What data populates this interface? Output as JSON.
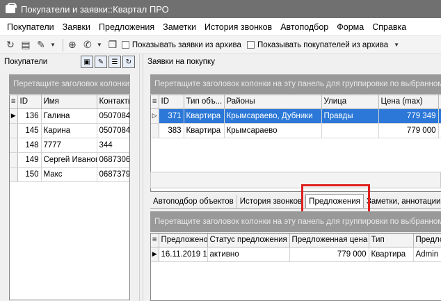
{
  "window": {
    "title": "Покупатели и заявки::Квартал ПРО"
  },
  "menu": [
    "Покупатели",
    "Заявки",
    "Предложения",
    "Заметки",
    "История звонков",
    "Автоподбор",
    "Форма",
    "Справка"
  ],
  "toolbar": {
    "show_archive_requests": "Показывать заявки из архива",
    "show_archive_buyers": "Показывать покупателей из архива"
  },
  "buyers": {
    "panel_title": "Покупатели",
    "group_hint": "Перетащите заголовок колонки",
    "columns": [
      "ID",
      "Имя",
      "Контакты"
    ],
    "rows": [
      {
        "id": "136",
        "name": "Галина",
        "contacts": "0507084"
      },
      {
        "id": "145",
        "name": "Карина",
        "contacts": "0507084"
      },
      {
        "id": "148",
        "name": "7777",
        "contacts": "344"
      },
      {
        "id": "149",
        "name": "Сергей Иванов",
        "contacts": "0687306"
      },
      {
        "id": "150",
        "name": "Макс",
        "contacts": "0687379"
      }
    ]
  },
  "requests": {
    "panel_title": "Заявки на покупку",
    "group_hint": "Перетащите заголовок колонки на эту панель для группировки по выбранному",
    "columns": [
      "ID",
      "Тип объ...",
      "Районы",
      "Улица",
      "Цена (max)",
      "Ко"
    ],
    "rows": [
      {
        "id": "371",
        "type": "Квартира",
        "districts": "Крымсараево, Дубники",
        "street": "Правды",
        "price": "779 349"
      },
      {
        "id": "383",
        "type": "Квартира",
        "districts": "Крымсараево",
        "street": "",
        "price": "779 000"
      }
    ]
  },
  "tabs": [
    "Автоподбор объектов",
    "История звонков",
    "Предложения",
    "Заметки, аннотации"
  ],
  "offers": {
    "group_hint": "Перетащите заголовок колонки на эту панель для группировки по выбранному",
    "columns": [
      "Предложено",
      "Статус предложения",
      "Предложенная цена",
      "Тип",
      "Предло"
    ],
    "rows": [
      {
        "date": "16.11.2019 1",
        "status": "активно",
        "price": "779 000",
        "type": "Квартира",
        "by": "Admin"
      }
    ]
  },
  "colors": {
    "titlebar": "#707070",
    "selection": "#2b78d8",
    "group_panel": "#999999",
    "highlight": "#e02020"
  }
}
